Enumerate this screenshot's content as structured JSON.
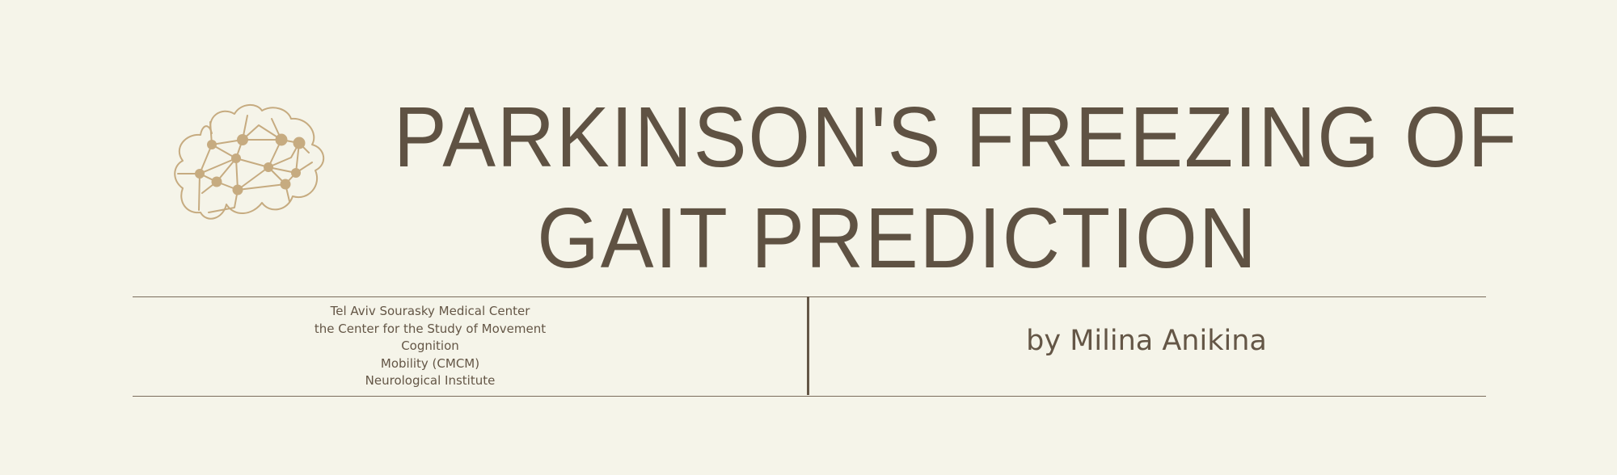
{
  "title": {
    "line1": "PARKINSON'S FREEZING OF",
    "line2": "GAIT PREDICTION"
  },
  "logo": {
    "icon": "brain-network-icon",
    "color": "#c6ab80"
  },
  "institution": {
    "lines": [
      "Tel Aviv Sourasky Medical Center",
      "the Center for the Study of Movement",
      "Cognition",
      "Mobility (CMCM)",
      "Neurological Institute"
    ]
  },
  "author": {
    "label": "by Milina Anikina"
  },
  "colors": {
    "background": "#f5f4e9",
    "text": "#645646",
    "accent": "#c6ab80"
  }
}
